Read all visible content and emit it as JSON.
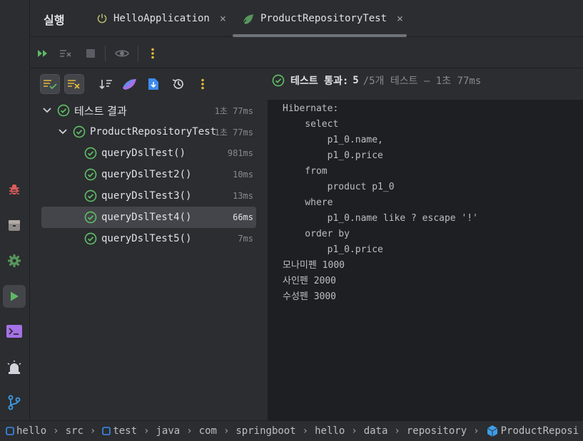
{
  "run_panel": {
    "title": "실행",
    "tabs": [
      {
        "label": "HelloApplication",
        "close": "×"
      },
      {
        "label": "ProductRepositoryTest",
        "close": "×"
      }
    ]
  },
  "status": {
    "pass_label": "테스트 통과:",
    "pass_count": "5",
    "rest": "/5개 테스트 – 1초 77ms"
  },
  "tree": {
    "root": {
      "label": "테스트 결과",
      "time": "1초 77ms"
    },
    "class": {
      "label": "ProductRepositoryTest",
      "time": "1초 77ms"
    },
    "tests": [
      {
        "label": "queryDslTest()",
        "time": "981ms"
      },
      {
        "label": "queryDslTest2()",
        "time": "10ms"
      },
      {
        "label": "queryDslTest3()",
        "time": "13ms"
      },
      {
        "label": "queryDslTest4()",
        "time": "66ms",
        "selected": true
      },
      {
        "label": "queryDslTest5()",
        "time": "7ms"
      }
    ]
  },
  "console": {
    "lines": [
      "Hibernate:",
      "    select",
      "        p1_0.name,",
      "        p1_0.price",
      "    from",
      "        product p1_0",
      "    where",
      "        p1_0.name like ? escape '!'",
      "    order by",
      "        p1_0.price",
      "모나미펜 1000",
      "사인펜 2000",
      "수성펜 3000"
    ]
  },
  "breadcrumb": [
    "hello",
    "src",
    "test",
    "java",
    "com",
    "springboot",
    "hello",
    "data",
    "repository",
    "ProductReposi"
  ],
  "breadcrumb_sep": "›",
  "colors": {
    "pass_green": "#5fb865",
    "run_green": "#57965c",
    "accent_blue": "#3574f0",
    "background": "#2b2d30",
    "console_bg": "#1e1f22"
  },
  "icons": {
    "strip": [
      "debug-icon",
      "services-icon",
      "settings-icon",
      "run-icon",
      "terminal-icon",
      "notifications-icon",
      "git-icon"
    ],
    "toolbar": [
      "rerun-icon",
      "stop-rerun-icon",
      "stop-icon",
      "view-icon",
      "more-icon"
    ],
    "tree_toolbar": [
      "show-passed-icon",
      "show-ignored-icon",
      "sort-icon",
      "spring-icon",
      "export-icon",
      "history-icon",
      "more-icon"
    ]
  }
}
